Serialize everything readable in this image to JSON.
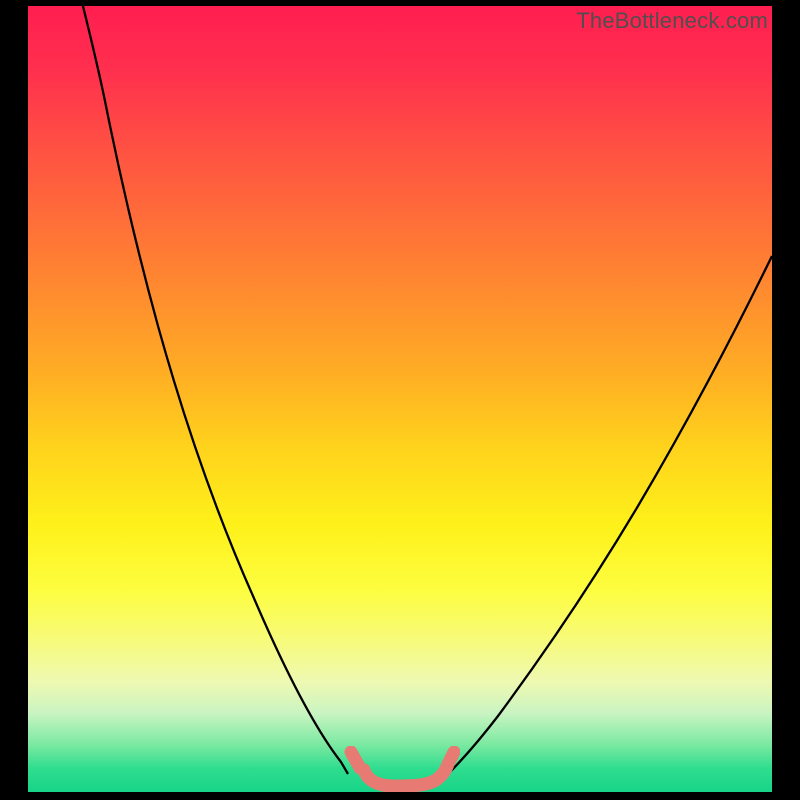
{
  "watermark": "TheBottleneck.com",
  "chart_data": {
    "type": "line",
    "title": "",
    "xlabel": "",
    "ylabel": "",
    "x": [
      0.0,
      0.02,
      0.04,
      0.06,
      0.08,
      0.1,
      0.12,
      0.14,
      0.16,
      0.18,
      0.2,
      0.22,
      0.24,
      0.26,
      0.28,
      0.3,
      0.32,
      0.34,
      0.36,
      0.38,
      0.4,
      0.42,
      0.44,
      0.46,
      0.48,
      0.5,
      0.52,
      0.54,
      0.56,
      0.58,
      0.6,
      0.62,
      0.64,
      0.66,
      0.68,
      0.7,
      0.72,
      0.74,
      0.76,
      0.78,
      0.8,
      0.82,
      0.84,
      0.86,
      0.88,
      0.9,
      0.92,
      0.94,
      0.96,
      0.98,
      1.0
    ],
    "series": [
      {
        "name": "left-curve",
        "values": [
          1.0,
          1.0,
          1.0,
          1.0,
          1.0,
          0.99,
          0.97,
          0.93,
          0.89,
          0.84,
          0.79,
          0.73,
          0.68,
          0.62,
          0.56,
          0.51,
          0.45,
          0.4,
          0.35,
          0.3,
          0.25,
          0.21,
          0.17,
          0.13,
          0.09,
          0.06,
          0.04,
          0.02,
          0.01,
          0.0,
          0.0,
          null,
          null,
          null,
          null,
          null,
          null,
          null,
          null,
          null,
          null,
          null,
          null,
          null,
          null,
          null,
          null,
          null,
          null,
          null,
          null
        ]
      },
      {
        "name": "right-curve",
        "values": [
          null,
          null,
          null,
          null,
          null,
          null,
          null,
          null,
          null,
          null,
          null,
          null,
          null,
          null,
          null,
          null,
          null,
          null,
          null,
          null,
          null,
          null,
          null,
          null,
          null,
          null,
          null,
          null,
          null,
          0.0,
          0.0,
          0.01,
          0.02,
          0.03,
          0.05,
          0.07,
          0.1,
          0.13,
          0.16,
          0.2,
          0.24,
          0.28,
          0.32,
          0.37,
          0.42,
          0.47,
          0.52,
          0.58,
          0.64,
          0.7,
          0.76
        ]
      }
    ],
    "xlim": [
      0,
      1
    ],
    "ylim": [
      0,
      1
    ],
    "background": "rainbow-vertical",
    "axes_shown": false,
    "grid": false,
    "bottom_marker": {
      "x_range": [
        0.41,
        0.59
      ],
      "shape": "chain-segments",
      "color": "#e77b74"
    }
  },
  "colors": {
    "frame": "#000000",
    "watermark": "#4f4f4f",
    "curve": "#000000",
    "marker": "#e77b74"
  }
}
